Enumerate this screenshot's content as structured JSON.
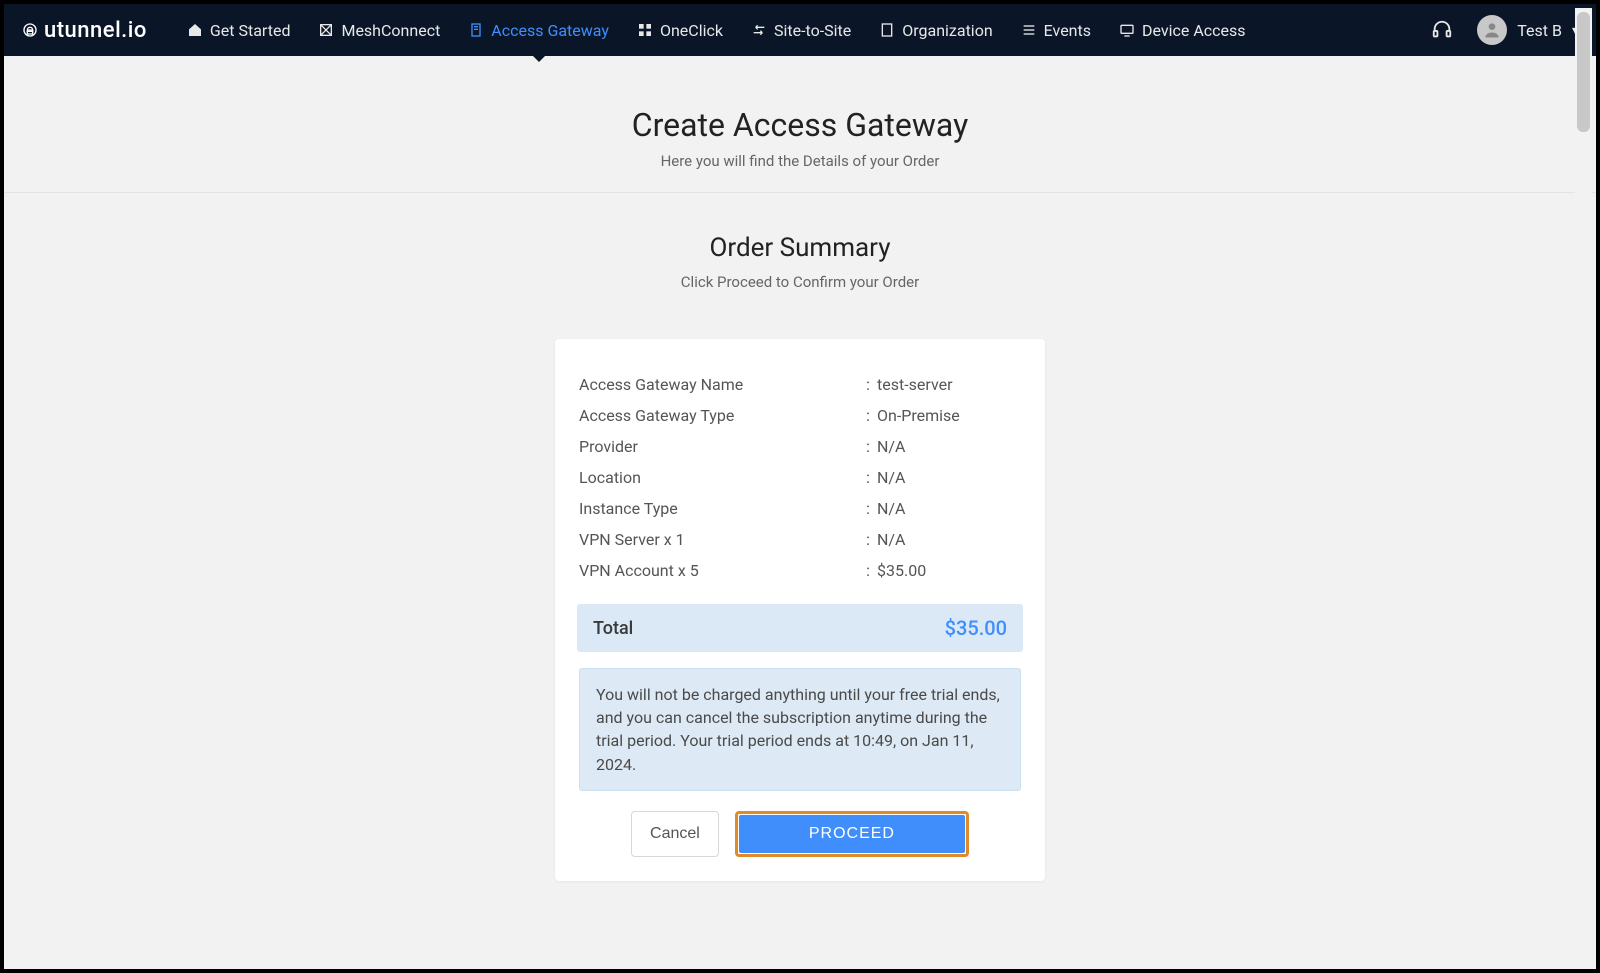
{
  "brand": "utunnel.io",
  "nav": {
    "items": [
      {
        "label": "Get Started",
        "icon": "home-icon",
        "active": false
      },
      {
        "label": "MeshConnect",
        "icon": "mesh-icon",
        "active": false
      },
      {
        "label": "Access Gateway",
        "icon": "gateway-icon",
        "active": true
      },
      {
        "label": "OneClick",
        "icon": "grid-icon",
        "active": false
      },
      {
        "label": "Site-to-Site",
        "icon": "swap-icon",
        "active": false
      },
      {
        "label": "Organization",
        "icon": "building-icon",
        "active": false
      },
      {
        "label": "Events",
        "icon": "list-icon",
        "active": false
      },
      {
        "label": "Device Access",
        "icon": "monitor-icon",
        "active": false
      }
    ],
    "support_icon": "headset-icon",
    "user": {
      "name": "Test B",
      "caret": "▾"
    }
  },
  "page": {
    "title": "Create Access Gateway",
    "subtitle": "Here you will find the Details of your Order"
  },
  "section": {
    "title": "Order Summary",
    "subtitle": "Click Proceed to Confirm your Order"
  },
  "order": {
    "rows": [
      {
        "label": "Access Gateway Name",
        "value": "test-server"
      },
      {
        "label": "Access Gateway Type",
        "value": "On-Premise"
      },
      {
        "label": "Provider",
        "value": "N/A"
      },
      {
        "label": "Location",
        "value": "N/A"
      },
      {
        "label": "Instance Type",
        "value": "N/A"
      },
      {
        "label": "VPN Server x 1",
        "value": "N/A"
      },
      {
        "label": "VPN Account x 5",
        "value": "$35.00"
      }
    ],
    "total_label": "Total",
    "total_value": "$35.00",
    "notice": "You will not be charged anything until your free trial ends, and you can cancel the subscription anytime during the trial period. Your trial period ends at 10:49, on Jan 11, 2024."
  },
  "actions": {
    "cancel": "Cancel",
    "proceed": "PROCEED"
  }
}
